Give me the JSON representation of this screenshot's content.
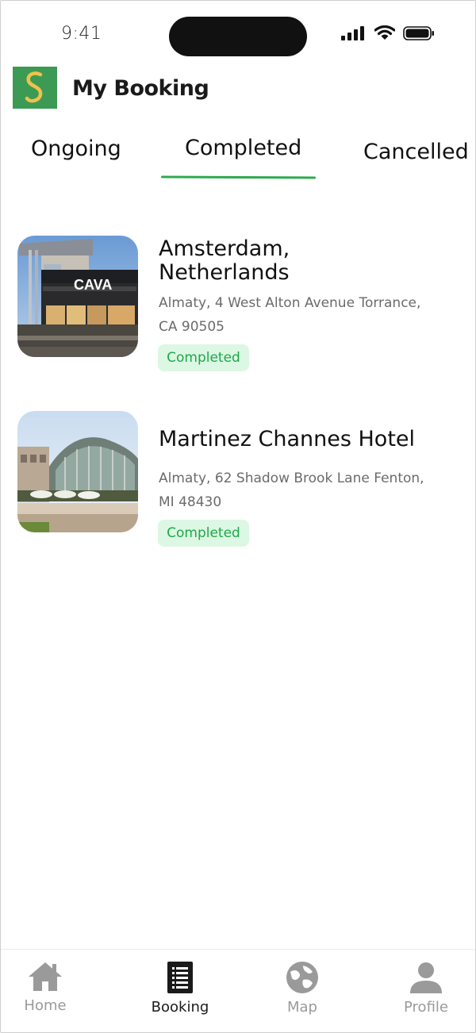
{
  "status_bar": {
    "time": "9:41"
  },
  "header": {
    "logo_letter": "S",
    "title": "My Booking"
  },
  "tabs": [
    {
      "label": "Ongoing",
      "active": false
    },
    {
      "label": "Completed",
      "active": true
    },
    {
      "label": "Cancelled",
      "active": false
    }
  ],
  "bookings": [
    {
      "name": "Amsterdam, Netherlands",
      "name_line1": "Amsterdam,",
      "name_line2": "Netherlands",
      "address_line1": "Almaty, 4 West Alton Avenue Torrance,",
      "address_line2": "CA 90505",
      "status": "Completed",
      "image_sign": "CAVA"
    },
    {
      "name": "Martinez Channes Hotel",
      "address_line1": "Almaty, 62 Shadow Brook Lane Fenton,",
      "address_line2": "MI 48430",
      "status": "Completed"
    }
  ],
  "bottom_nav": [
    {
      "label": "Home",
      "icon": "home-icon",
      "active": false
    },
    {
      "label": "Booking",
      "icon": "booking-icon",
      "active": true
    },
    {
      "label": "Map",
      "icon": "globe-icon",
      "active": false
    },
    {
      "label": "Profile",
      "icon": "person-icon",
      "active": false
    }
  ],
  "colors": {
    "accent": "#2eaa4f",
    "badge_bg": "#dcf7e3",
    "badge_text": "#1ea84a",
    "logo_bg": "#3d9a55",
    "logo_letter": "#f0c24a",
    "inactive_nav": "#9a9a9a"
  }
}
